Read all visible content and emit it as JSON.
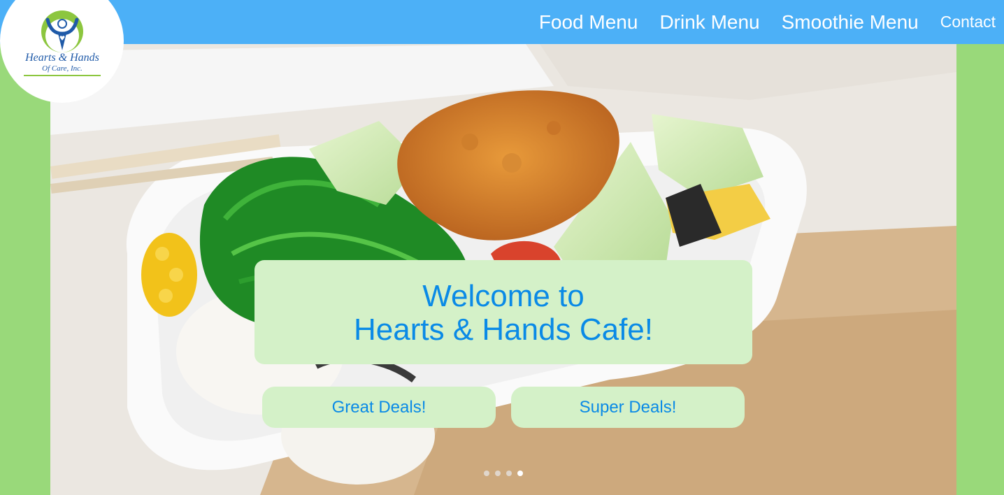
{
  "brand": {
    "logo_line1": "Hearts & Hands",
    "logo_line2": "Of Care, Inc."
  },
  "nav": {
    "items": [
      {
        "label": "Food Menu"
      },
      {
        "label": "Drink Menu"
      },
      {
        "label": "Smoothie Menu"
      },
      {
        "label": "Contact"
      }
    ]
  },
  "hero": {
    "welcome_line1": "Welcome to",
    "welcome_line2": "Hearts & Hands Cafe!",
    "buttons": [
      {
        "label": "Great Deals!"
      },
      {
        "label": "Super Deals!"
      }
    ],
    "slides": {
      "count": 4,
      "active_index": 3
    }
  },
  "colors": {
    "header": "#4cb0f7",
    "page_bg": "#99d97a",
    "card_bg": "#d4f1c8",
    "accent_text": "#0a8ae6"
  }
}
